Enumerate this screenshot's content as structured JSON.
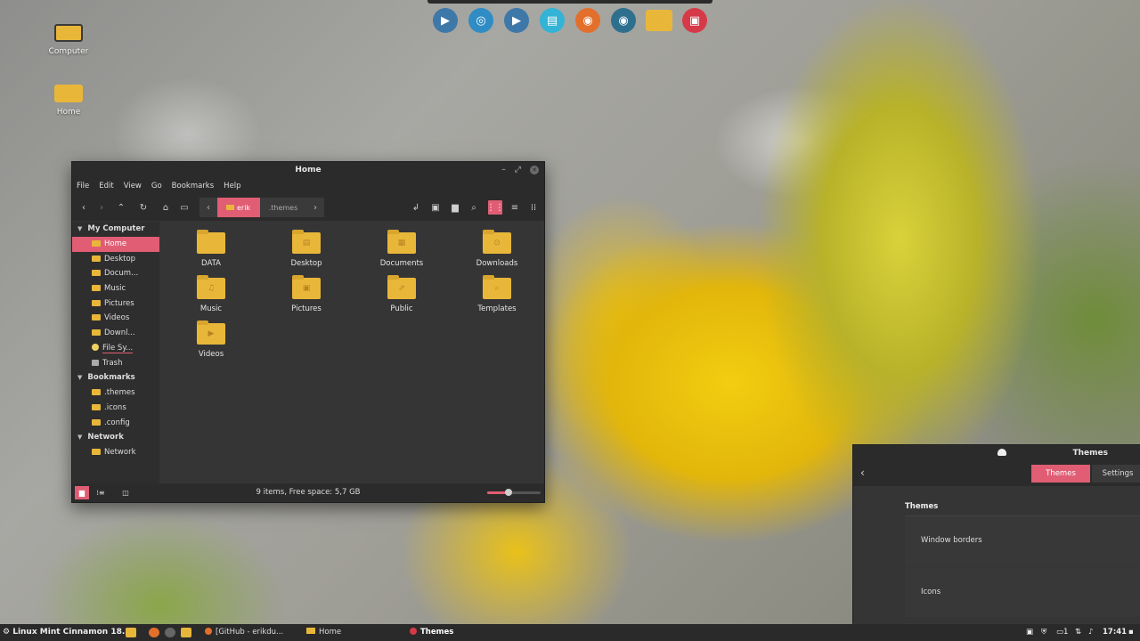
{
  "colors": {
    "accent": "#e05d74",
    "folder": "#e8b73a",
    "window_bg": "#353535",
    "titlebar_bg": "#2b2b2b",
    "panel_bg": "#2a2a2a"
  },
  "dock": {
    "items": [
      {
        "icon": "video-player-icon",
        "color": "#3e78a8"
      },
      {
        "icon": "browser-spiral-icon",
        "color": "#2f8cc4"
      },
      {
        "icon": "video-player-icon",
        "color": "#3e78a8"
      },
      {
        "icon": "software-store-icon",
        "color": "#33b3d6"
      },
      {
        "icon": "firefox-icon",
        "color": "#e36f2c"
      },
      {
        "icon": "eye-icon",
        "color": "#2e6f8e"
      },
      {
        "icon": "folder-icon",
        "color": "#e8b73a"
      },
      {
        "icon": "media-recorder-icon",
        "color": "#d63a48"
      }
    ]
  },
  "desktop": {
    "icons": [
      {
        "label": "Computer",
        "icon": "computer-icon"
      },
      {
        "label": "Home",
        "icon": "home-folder-icon"
      }
    ]
  },
  "file_manager": {
    "title": "Home",
    "menu": [
      "File",
      "Edit",
      "View",
      "Go",
      "Bookmarks",
      "Help"
    ],
    "breadcrumb": {
      "current": "erik",
      "next": ".themes"
    },
    "sidebar": {
      "my_computer": {
        "heading": "My Computer",
        "items": [
          "Home",
          "Desktop",
          "Docum...",
          "Music",
          "Pictures",
          "Videos",
          "Downl...",
          "File Sy...",
          "Trash"
        ]
      },
      "bookmarks": {
        "heading": "Bookmarks",
        "items": [
          ".themes",
          ".icons",
          ".config"
        ]
      },
      "network": {
        "heading": "Network",
        "items": [
          "Network"
        ]
      }
    },
    "files": [
      {
        "label": "DATA",
        "emblem": ""
      },
      {
        "label": "Desktop",
        "emblem": "▤"
      },
      {
        "label": "Documents",
        "emblem": "▦"
      },
      {
        "label": "Downloads",
        "emblem": "⊙"
      },
      {
        "label": "Music",
        "emblem": "♫"
      },
      {
        "label": "Pictures",
        "emblem": "▣"
      },
      {
        "label": "Public",
        "emblem": "⇗"
      },
      {
        "label": "Templates",
        "emblem": "⌕"
      },
      {
        "label": "Videos",
        "emblem": "▶"
      }
    ],
    "status": "9 items, Free space: 5,7 GB",
    "zoom_level_fraction": 0.4
  },
  "themes_window": {
    "title": "Themes",
    "tabs": [
      "Themes",
      "Settings"
    ],
    "section": "Themes",
    "rows": [
      "Window borders",
      "Icons"
    ]
  },
  "panel": {
    "menu_label": "Linux Mint Cinnamon 18.2",
    "tasks": [
      "[GitHub - erikdu...",
      "Home",
      "Themes"
    ],
    "tray_count": "1",
    "clock": "17:41"
  }
}
